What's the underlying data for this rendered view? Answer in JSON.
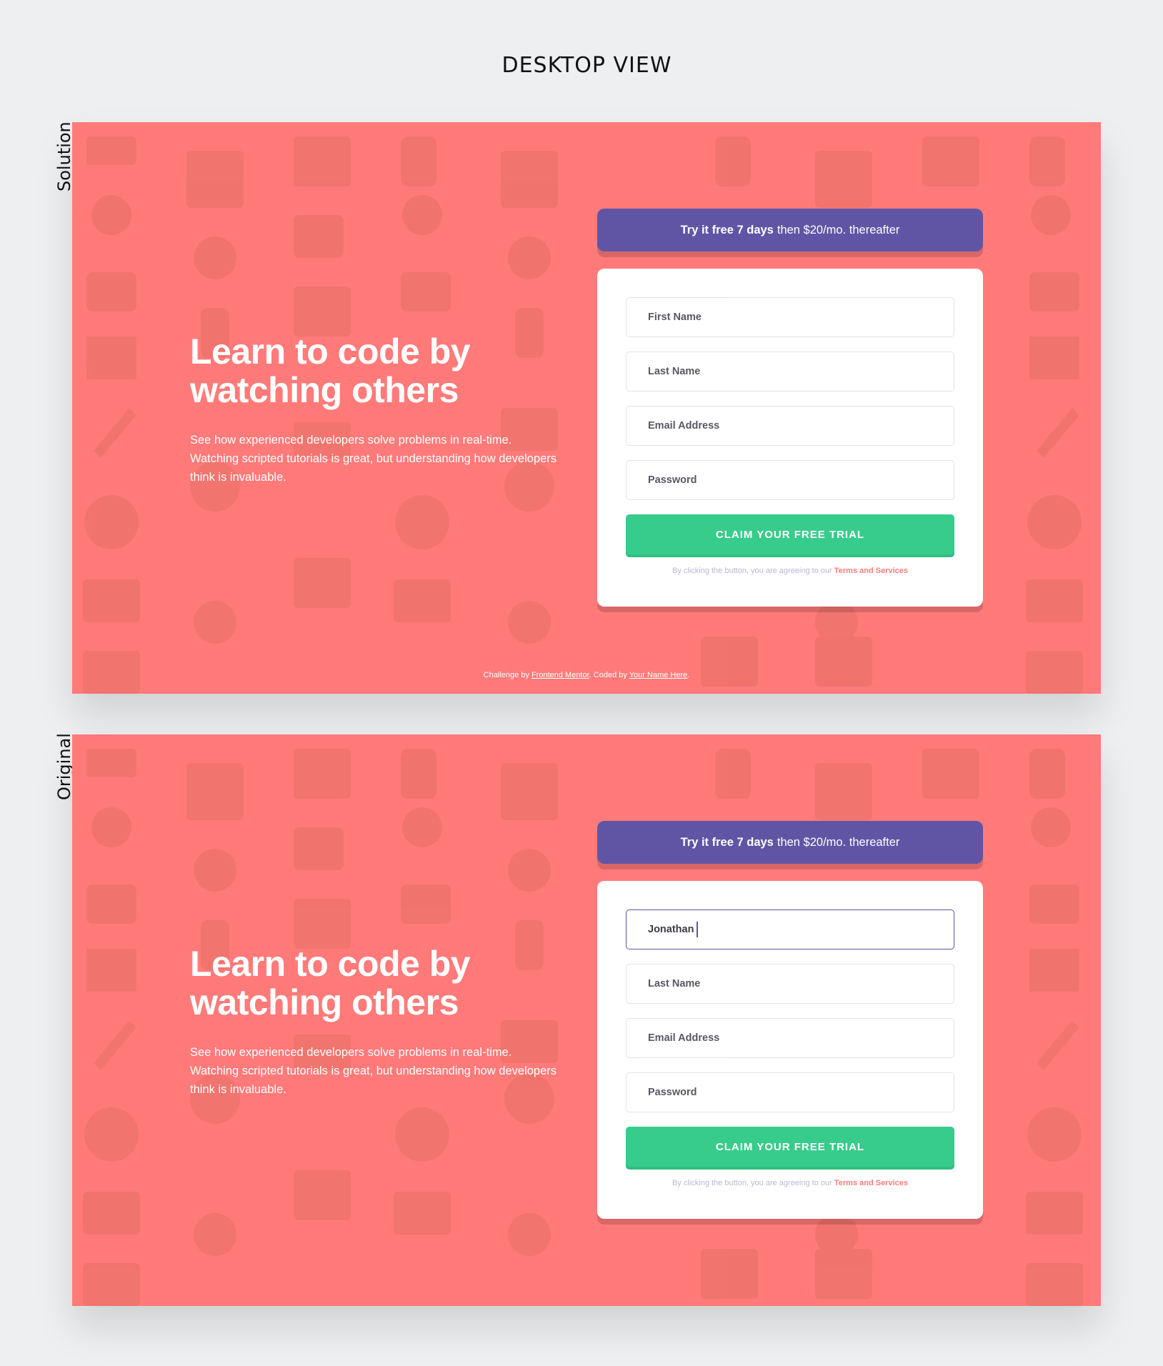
{
  "page": {
    "view_title": "DESKTOP VIEW",
    "solution_label": "Solution",
    "original_label": "Original"
  },
  "colors": {
    "background": "#ff7a79",
    "banner": "#6055a5",
    "button": "#38cc8c",
    "accent_red": "#ff7a7a",
    "focus_border": "#5e54a4"
  },
  "hero": {
    "title_line1": "Learn to code by",
    "title_line2": "watching others",
    "description": "See how experienced developers solve problems in real-time. Watching scripted tutorials is great, but understanding how developers think is invaluable."
  },
  "banner": {
    "bold_text": "Try it free 7 days",
    "rest_text": "then $20/mo. thereafter"
  },
  "form": {
    "first_name_placeholder": "First Name",
    "last_name_placeholder": "Last Name",
    "email_placeholder": "Email Address",
    "password_placeholder": "Password",
    "first_name_value_original": "Jonathan",
    "submit_label": "Claim your free trial",
    "terms_text": "By clicking the button, you are agreeing to our",
    "terms_link": "Terms and Services"
  },
  "attribution": {
    "prefix": "Challenge by",
    "link1": "Frontend Mentor",
    "middle": ". Coded by",
    "link2": "Your Name Here",
    "suffix": "."
  }
}
